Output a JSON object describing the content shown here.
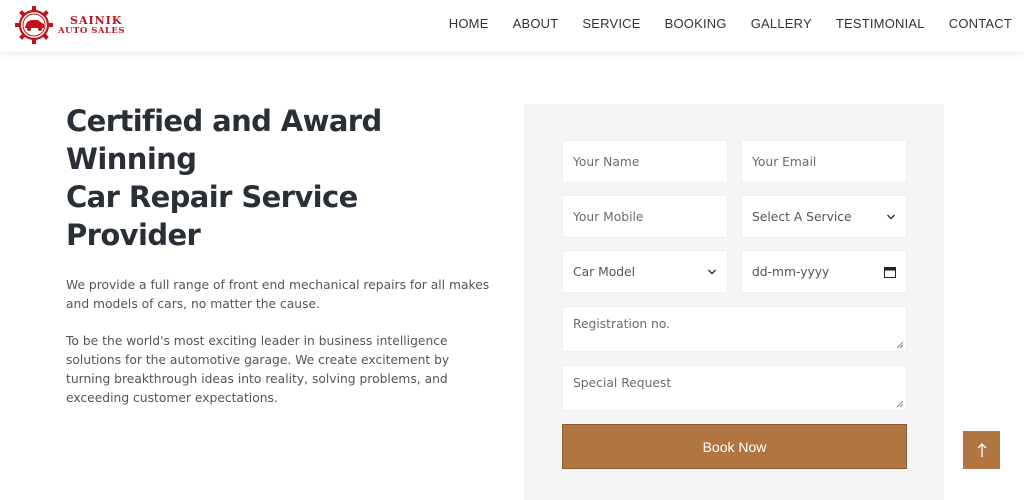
{
  "brand": {
    "line1": "SAINIK",
    "line2": "AUTO SALES",
    "logo_color": "#c0141c"
  },
  "nav": {
    "items": [
      {
        "label": "HOME"
      },
      {
        "label": "ABOUT"
      },
      {
        "label": "SERVICE"
      },
      {
        "label": "BOOKING"
      },
      {
        "label": "GALLERY"
      },
      {
        "label": "TESTIMONIAL"
      },
      {
        "label": "CONTACT"
      }
    ]
  },
  "hero": {
    "headline_line1": "Certified and Award Winning",
    "headline_line2": "Car Repair Service Provider",
    "paragraph1": "We provide a full range of front end mechanical repairs for all makes and models of cars, no matter the cause.",
    "paragraph2": "To be the world's most exciting leader in business intelligence solutions for the automotive garage. We create excitement by turning breakthrough ideas into reality, solving problems, and exceeding customer expectations."
  },
  "form": {
    "name_placeholder": "Your Name",
    "email_placeholder": "Your Email",
    "mobile_placeholder": "Your Mobile",
    "service_select": "Select A Service",
    "car_model_select": "Car Model",
    "date_placeholder": "dd-mm-yyyy",
    "registration_placeholder": "Registration no.",
    "special_request_placeholder": "Special Request",
    "submit_label": "Book Now"
  },
  "colors": {
    "accent": "#b07540",
    "panel_bg": "#f5f5f5",
    "headline": "#2a2f37"
  },
  "icons": {
    "back_to_top": "arrow-up-icon",
    "select": "chevron-down-icon",
    "date": "calendar-icon"
  }
}
